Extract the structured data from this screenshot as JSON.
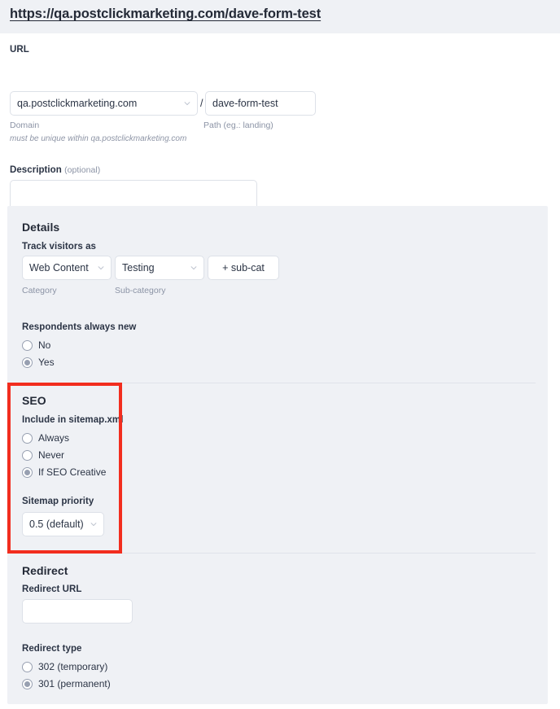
{
  "header": {
    "title": "https://qa.postclickmarketing.com/dave-form-test"
  },
  "url_section": {
    "label": "URL",
    "domain_value": "qa.postclickmarketing.com",
    "separator": "/",
    "path_value": "dave-form-test",
    "path_placeholder": "",
    "domain_hint": "Domain",
    "path_hint": "Path (eg.: landing)",
    "unique_hint": "must be unique within qa.postclickmarketing.com"
  },
  "description_section": {
    "label": "Description",
    "optional": "(optional)",
    "value": "",
    "placeholder": ""
  },
  "details": {
    "title": "Details",
    "track_label": "Track visitors as",
    "category_value": "Web Content",
    "subcategory_value": "Testing",
    "add_subcat_label": "+ sub-cat",
    "category_hint": "Category",
    "subcategory_hint": "Sub-category",
    "respondents_label": "Respondents always new",
    "respondents_options": [
      {
        "label": "No",
        "checked": false
      },
      {
        "label": "Yes",
        "checked": true
      }
    ]
  },
  "seo": {
    "title": "SEO",
    "sitemap_label": "Include in sitemap.xml",
    "sitemap_options": [
      {
        "label": "Always",
        "checked": false
      },
      {
        "label": "Never",
        "checked": false
      },
      {
        "label": "If SEO Creative",
        "checked": true
      }
    ],
    "priority_label": "Sitemap priority",
    "priority_value": "0.5 (default)",
    "highlight_color": "#f22d1e"
  },
  "redirect": {
    "title": "Redirect",
    "url_label": "Redirect URL",
    "url_value": "",
    "url_placeholder": "",
    "type_label": "Redirect type",
    "type_options": [
      {
        "label": "302 (temporary)",
        "checked": false
      },
      {
        "label": "301 (permanent)",
        "checked": true
      }
    ]
  },
  "icons": {
    "chevron_down": "chevron-down-icon",
    "resize": "resize-grip-icon"
  },
  "colors": {
    "panel_bg": "#eff1f5",
    "page_bg": "#ffffff",
    "text": "#2b3445",
    "muted": "#8b93a5",
    "border": "#dde1e8",
    "accent_highlight": "#f22d1e"
  }
}
